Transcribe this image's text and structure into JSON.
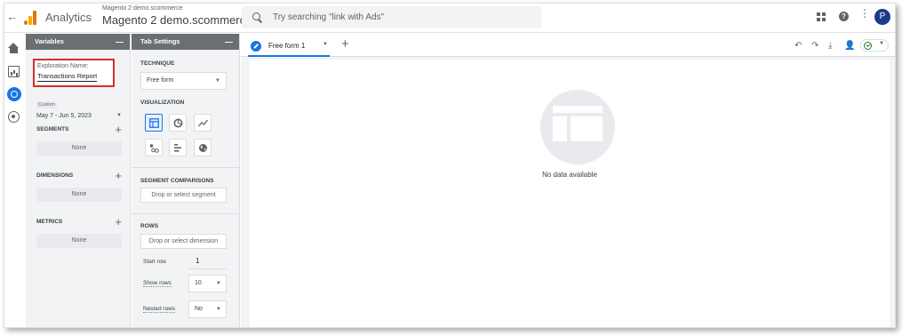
{
  "header": {
    "app_name": "Analytics",
    "account": "Magento 2 demo.scommerce",
    "property": "Magento 2 demo.scommerce",
    "search_placeholder": "Try searching \"link with Ads\"",
    "avatar_letter": "P"
  },
  "variables": {
    "title": "Variables",
    "minimize": "—",
    "exploration_name_label": "Exploration Name:",
    "exploration_name_value": "Transactions Report",
    "date_range_tag": "Custom",
    "date_range": "May 7 - Jun 5, 2023",
    "segments": {
      "title": "SEGMENTS",
      "empty": "None"
    },
    "dimensions": {
      "title": "DIMENSIONS",
      "empty": "None"
    },
    "metrics": {
      "title": "METRICS",
      "empty": "None"
    }
  },
  "tab_settings": {
    "title": "Tab Settings",
    "minimize": "—",
    "technique_label": "TECHNIQUE",
    "technique_value": "Free form",
    "visualization_label": "VISUALIZATION",
    "segment_comparisons_label": "SEGMENT COMPARISONS",
    "segment_drop": "Drop or select segment",
    "rows_label": "ROWS",
    "rows_drop": "Drop or select dimension",
    "start_row_label": "Start row",
    "start_row_value": "1",
    "show_rows_label": "Show rows",
    "show_rows_value": "10",
    "nested_rows_label": "Nested rows",
    "nested_rows_value": "No"
  },
  "canvas": {
    "tab_label": "Free form 1",
    "empty_message": "No data available"
  },
  "colors": {
    "accent": "#1a73e8",
    "highlight_box": "#d32f2f",
    "panel_header": "#6b6e72",
    "logo_orange": "#e37400",
    "logo_yellow": "#f9ab00"
  }
}
